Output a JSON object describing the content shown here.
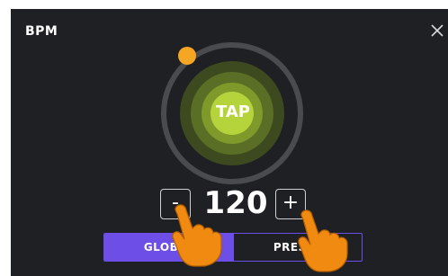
{
  "dialog": {
    "title": "BPM"
  },
  "tap": {
    "label": "TAP"
  },
  "tempo": {
    "value": "120",
    "decrement_label": "-",
    "increment_label": "+"
  },
  "tabs": [
    {
      "label": "GLOBAL",
      "active": true
    },
    {
      "label": "PRESET",
      "active": false
    }
  ],
  "colors": {
    "background": "#1f2023",
    "accent_purple": "#6d4ee6",
    "tap_green": "#b5d43c",
    "ring_gray": "#4a4b4f",
    "beat_dot_orange": "#f5a623",
    "hand_orange": "#f08a10"
  },
  "icons": {
    "close": "close-icon",
    "hand": "pointing-hand-icon"
  }
}
